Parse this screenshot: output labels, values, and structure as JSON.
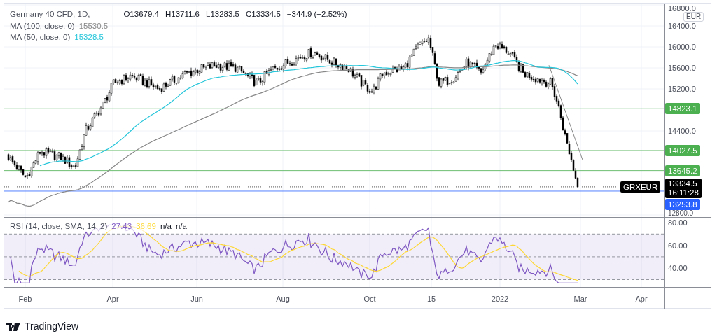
{
  "legend": {
    "symbol": "Germany 40 CFD, 1D,",
    "ohlc": [
      {
        "label": "O",
        "value": "13679.4"
      },
      {
        "label": "H",
        "value": "13711.6"
      },
      {
        "label": "L",
        "value": "13283.5"
      },
      {
        "label": "C",
        "value": "13334.5"
      }
    ],
    "change": "−344.9 (−2.52%)"
  },
  "indicators": [
    {
      "name": "MA (100, close, 0)",
      "value": "15530.5",
      "color": "#888888"
    },
    {
      "name": "MA (50, close, 0)",
      "value": "15328.5",
      "color": "#26c6da"
    }
  ],
  "price_axis": {
    "currency": "EUR",
    "ticks": [
      "16800.0",
      "16400.0",
      "16000.0",
      "15600.0",
      "15200.0",
      "14400.0",
      "12800.0"
    ]
  },
  "level_labels": [
    {
      "text": "14823.1",
      "color": "#4caf50"
    },
    {
      "text": "14027.5",
      "color": "#4caf50"
    },
    {
      "text": "13645.2",
      "color": "#4caf50"
    },
    {
      "text": "13253.8",
      "color": "#2962ff"
    }
  ],
  "last_price": {
    "symbol": "GRXEUR",
    "price": "13334.5",
    "countdown": "16:11:28"
  },
  "rsi": {
    "legend": "RSI (14, close, SMA, 14, 2)",
    "values": [
      {
        "text": "27.43",
        "color": "#7e57c2"
      },
      {
        "text": "36.69",
        "color": "#fdd835"
      },
      {
        "text": "n/a",
        "color": "#131722"
      },
      {
        "text": "n/a",
        "color": "#131722"
      }
    ],
    "ticks": [
      "80.00",
      "60.00",
      "40.00"
    ]
  },
  "time_axis": [
    "Feb",
    "Apr",
    "Jun",
    "Aug",
    "Oct",
    "15",
    "2022",
    "Mar",
    "Apr"
  ],
  "brand": "TradingView"
}
